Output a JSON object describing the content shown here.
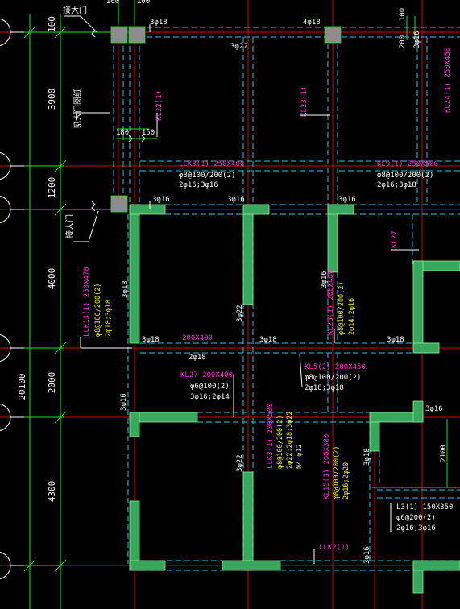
{
  "dimensions": {
    "total": "20100",
    "spans": [
      "100",
      "3900",
      "1200",
      "4000",
      "2000",
      "4300"
    ],
    "top_small": [
      "100",
      "100"
    ],
    "col_180": "180",
    "col_150": "150",
    "right_200": "200",
    "right_100": "100",
    "right_2100": "2100"
  },
  "labels": {
    "pei_da_men_top": "接大门",
    "pei_da_men_bottom": "接大门",
    "da_men_outline": "见大门图纸"
  },
  "beams": {
    "llk8": {
      "name": "LLK8(1) 250X400",
      "stirrup": "φ8@100/200(2)",
      "bars": "2φ16;3φ16"
    },
    "kl9": {
      "name": "KL9(1) 250X500",
      "stirrup": "φ8@100/200(2)",
      "bars": "2φ16;3φ18"
    },
    "kl22": "KL22(1)",
    "kl23": "KL23(1)",
    "kl24": "KL24(1) 250X450",
    "kl27_right": "KL27",
    "llk13": {
      "name": "LLK13(1) 250X470",
      "stirrup": "φ8@100/200(2)",
      "bars": "2φ18;3φ18"
    },
    "kl26": {
      "name": "KL26(1) 200X400",
      "stirrup": "φ8@100/200(2)",
      "bars": "2φ14;2φ16"
    },
    "sec_200x400": "200X400",
    "kl27": {
      "name": "KL27 200X400",
      "stirrup": "φ6@100(2)",
      "bars": "3φ16;2φ14"
    },
    "kl5": {
      "name": "KL5(2) 200X450",
      "stirrup": "φ8@100/200(2)",
      "bars": "2φ18;3φ18"
    },
    "llk3": {
      "name": "LLK3(1) 200X500",
      "stirrup": "φ8@100/200(2)",
      "bars": "2φ22;2φ18;3φ22",
      "extra": "N4 φ12"
    },
    "kl15": {
      "name": "KL15(1) 200X380",
      "stirrup": "φ8@100/200(2)",
      "bars": "2φ16;2φ20"
    },
    "l3": {
      "name": "L3(1) 150X350",
      "stirrup": "φ6@200(2)",
      "bars": "2φ16;3φ16"
    },
    "llk2": "LLK2(1)"
  },
  "rebar": {
    "r1": "3φ18",
    "r2": "4φ18",
    "r3": "3φ22",
    "r4": "3φ16",
    "r5": "3φ16",
    "r6": "3φ16",
    "r7": "3φ18",
    "r8": "3φ22",
    "r9": "3φ18",
    "r10": "3φ18",
    "r11": "2φ18",
    "r12": "3φ16",
    "r13": "3φ18",
    "r14": "3φ16",
    "r15": "3φ16",
    "r16": "3φ18",
    "r17": "3φ22",
    "r18": "3φ16",
    "r19": "3φ16"
  },
  "colors": {
    "background": "#000000",
    "axis": "#d40000",
    "dimension": "#19e619",
    "beam_dashed": "#29c6e8",
    "wall_fill": "#37a85e",
    "column_fill": "#8c8c8c",
    "beam_name": "#ff2bd6",
    "reinforcement": "#f4f41e",
    "text": "#ffffff"
  }
}
